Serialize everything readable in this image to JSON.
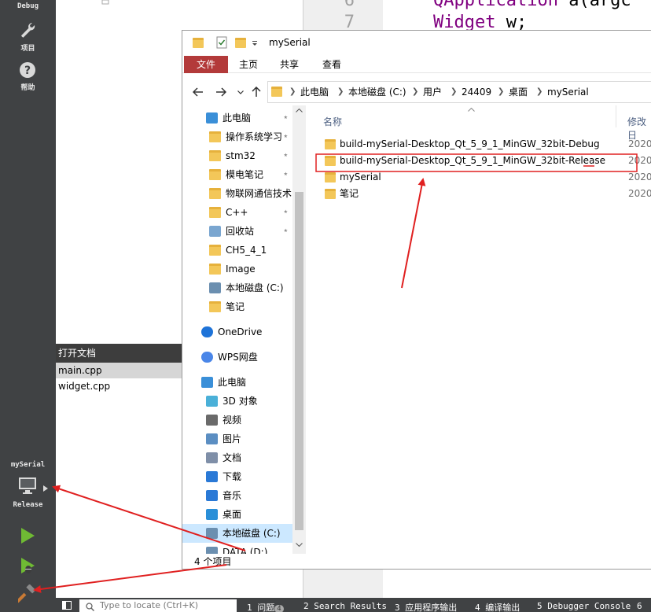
{
  "qt": {
    "modes": {
      "debug_label": "Debug",
      "projects_label": "项目",
      "help_label": "帮助"
    },
    "kit": {
      "project_name": "mySerial",
      "build_config": "Release"
    },
    "editor": {
      "line_numbers": [
        "6",
        "7"
      ],
      "code_lines": [
        {
          "kw": "QApplication",
          "rest": " a(argc"
        },
        {
          "kw": "Widget",
          "rest": " w;"
        }
      ]
    },
    "open_docs": {
      "header": "打开文档",
      "items": [
        "main.cpp",
        "widget.cpp"
      ]
    },
    "statusbar": {
      "locate_placeholder": "Type to locate (Ctrl+K)",
      "tabs": [
        {
          "label": "1 问题"
        },
        {
          "label": "2 Search Results"
        },
        {
          "label": "3 应用程序输出"
        },
        {
          "label": "4 编译输出"
        },
        {
          "label": "5 Debugger Console"
        },
        {
          "label": "6"
        }
      ],
      "problems_count": "4"
    }
  },
  "explorer": {
    "title": "mySerial",
    "ribbon_tabs": [
      "文件",
      "主页",
      "共享",
      "查看"
    ],
    "breadcrumbs": [
      "此电脑",
      "本地磁盘 (C:)",
      "用户",
      "24409",
      "桌面",
      "mySerial"
    ],
    "nav_items": [
      {
        "label": "此电脑",
        "icon": "pc-icon",
        "pinned": true
      },
      {
        "label": "操作系统学习",
        "icon": "folder-icon",
        "pinned": true
      },
      {
        "label": "stm32",
        "icon": "folder-icon",
        "pinned": true
      },
      {
        "label": "模电笔记",
        "icon": "folder-icon",
        "pinned": true
      },
      {
        "label": "物联网通信技术",
        "icon": "folder-icon",
        "pinned": true
      },
      {
        "label": "C++",
        "icon": "folder-icon",
        "pinned": true
      },
      {
        "label": "回收站",
        "icon": "recycle-bin-icon",
        "pinned": true
      },
      {
        "label": "CH5_4_1",
        "icon": "folder-icon",
        "pinned": false
      },
      {
        "label": "Image",
        "icon": "folder-icon",
        "pinned": false
      },
      {
        "label": "本地磁盘 (C:)",
        "icon": "drive-icon",
        "pinned": false
      },
      {
        "label": "笔记",
        "icon": "folder-icon",
        "pinned": false
      },
      {
        "label": "OneDrive",
        "icon": "cloud-icon",
        "pinned": false
      },
      {
        "label": "WPS网盘",
        "icon": "wps-cloud-icon",
        "pinned": false
      },
      {
        "label": "此电脑",
        "icon": "pc-icon",
        "pinned": false
      },
      {
        "label": "3D 对象",
        "icon": "3d-objects-icon",
        "pinned": false
      },
      {
        "label": "视频",
        "icon": "video-icon",
        "pinned": false
      },
      {
        "label": "图片",
        "icon": "pictures-icon",
        "pinned": false
      },
      {
        "label": "文档",
        "icon": "documents-icon",
        "pinned": false
      },
      {
        "label": "下载",
        "icon": "download-icon",
        "pinned": false
      },
      {
        "label": "音乐",
        "icon": "music-icon",
        "pinned": false
      },
      {
        "label": "桌面",
        "icon": "desktop-icon",
        "pinned": false
      },
      {
        "label": "本地磁盘 (C:)",
        "icon": "drive-icon",
        "pinned": false
      },
      {
        "label": "DATA (D:)",
        "icon": "drive-icon",
        "pinned": false
      }
    ],
    "columns": {
      "name": "名称",
      "modified": "修改日"
    },
    "files": [
      {
        "name": "build-mySerial-Desktop_Qt_5_9_1_MinGW_32bit-Debug",
        "date": "2020"
      },
      {
        "name": "build-mySerial-Desktop_Qt_5_9_1_MinGW_32bit-Release",
        "date": "2020"
      },
      {
        "name": "mySerial",
        "date": "2020"
      },
      {
        "name": "笔记",
        "date": "2020"
      }
    ],
    "status": "4 个项目"
  },
  "annotation_color": "#e02020"
}
